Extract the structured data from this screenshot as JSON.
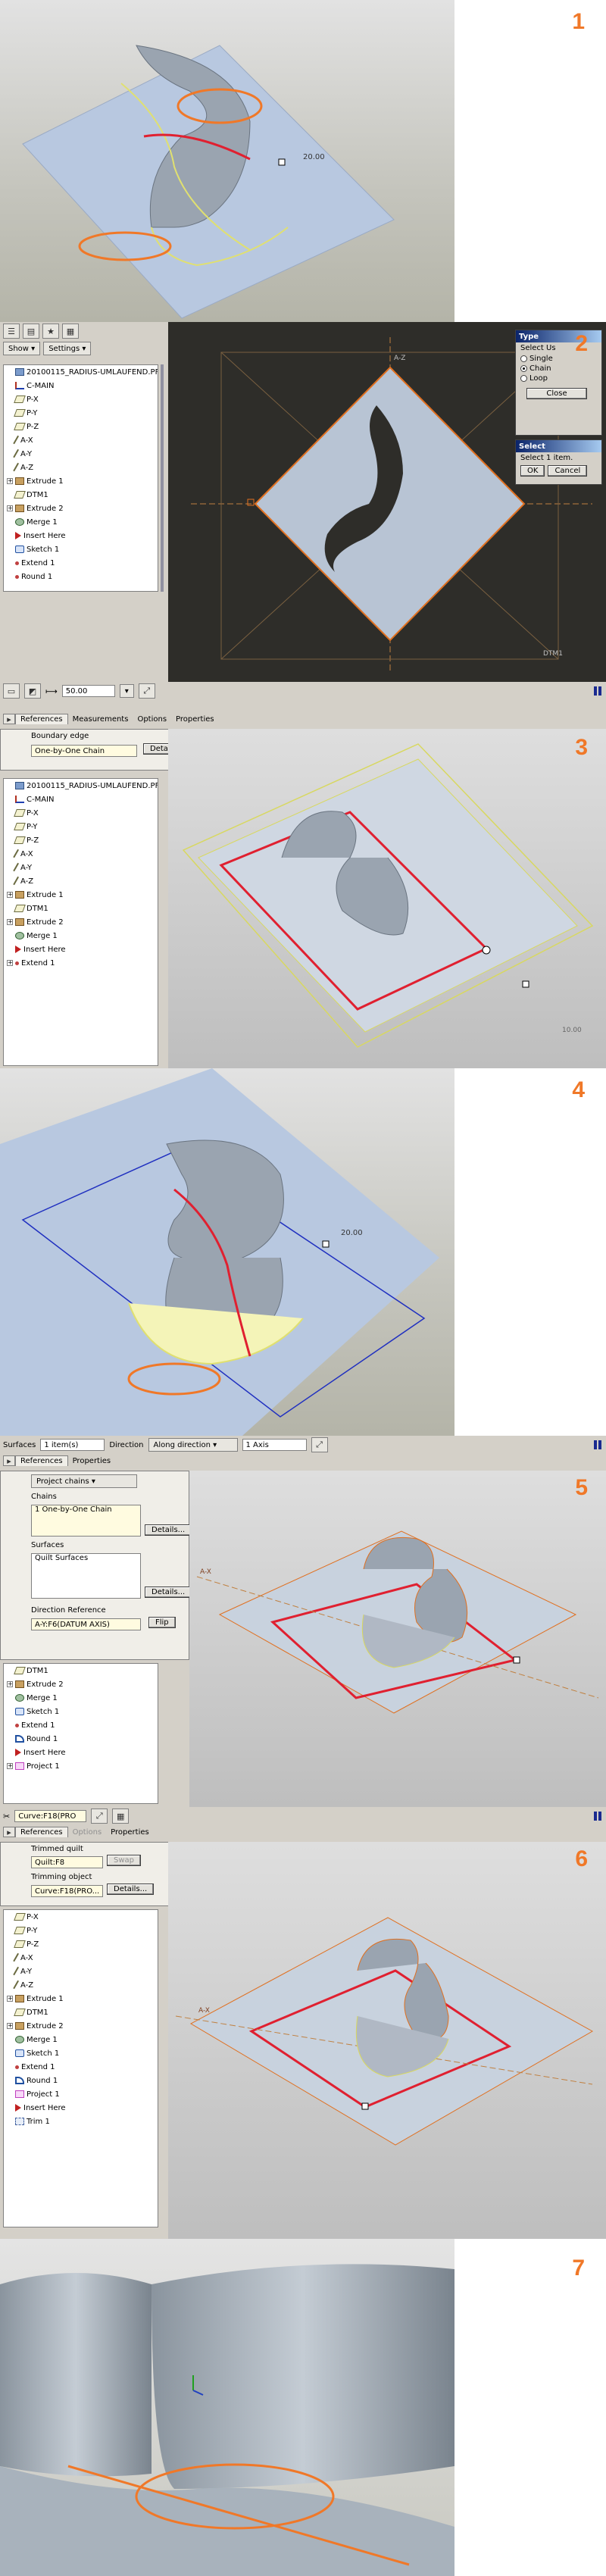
{
  "steps": [
    "1",
    "2",
    "3",
    "4",
    "5",
    "6",
    "7"
  ],
  "step1": {
    "dimension": "20.00"
  },
  "step2": {
    "toolbar": {
      "show_label": "Show",
      "settings_label": "Settings"
    },
    "tree": [
      {
        "label": "20100115_RADIUS-UMLAUFEND.PF",
        "icon": "part",
        "expander": ""
      },
      {
        "label": "C-MAIN",
        "icon": "csys",
        "expander": ""
      },
      {
        "label": "P-X",
        "icon": "plane",
        "expander": ""
      },
      {
        "label": "P-Y",
        "icon": "plane",
        "expander": ""
      },
      {
        "label": "P-Z",
        "icon": "plane",
        "expander": ""
      },
      {
        "label": "A-X",
        "icon": "axis",
        "expander": ""
      },
      {
        "label": "A-Y",
        "icon": "axis",
        "expander": ""
      },
      {
        "label": "A-Z",
        "icon": "axis",
        "expander": ""
      },
      {
        "label": "Extrude 1",
        "icon": "extrude",
        "expander": "+"
      },
      {
        "label": "DTM1",
        "icon": "plane",
        "expander": ""
      },
      {
        "label": "Extrude 2",
        "icon": "extrude",
        "expander": "+"
      },
      {
        "label": "Merge 1",
        "icon": "merge",
        "expander": ""
      },
      {
        "label": "Insert Here",
        "icon": "insert",
        "expander": ""
      },
      {
        "label": "Sketch 1",
        "icon": "sketch",
        "expander": ""
      },
      {
        "label": "Extend 1",
        "icon": "extend",
        "expander": ""
      },
      {
        "label": "Round 1",
        "icon": "extend",
        "expander": ""
      }
    ],
    "type_dialog": {
      "title": "Type",
      "select_using": "Select Us",
      "options": [
        "Single",
        "Chain",
        "Loop"
      ],
      "selected": "Chain",
      "close": "Close"
    },
    "select_dialog": {
      "title": "Select",
      "message": "Select 1 item.",
      "ok": "OK",
      "cancel": "Cancel"
    },
    "axis_labels": {
      "x": "A-X",
      "y": "A-Z",
      "dtm": "DTM1"
    },
    "dash_value": "50.00"
  },
  "step3": {
    "tabs": [
      "References",
      "Measurements",
      "Options",
      "Properties"
    ],
    "boundary_label": "Boundary edge",
    "boundary_value": "One-by-One Chain",
    "details": "Details...",
    "tree": [
      {
        "label": "20100115_RADIUS-UMLAUFEND.PF",
        "icon": "part",
        "expander": ""
      },
      {
        "label": "C-MAIN",
        "icon": "csys",
        "expander": ""
      },
      {
        "label": "P-X",
        "icon": "plane",
        "expander": ""
      },
      {
        "label": "P-Y",
        "icon": "plane",
        "expander": ""
      },
      {
        "label": "P-Z",
        "icon": "plane",
        "expander": ""
      },
      {
        "label": "A-X",
        "icon": "axis",
        "expander": ""
      },
      {
        "label": "A-Y",
        "icon": "axis",
        "expander": ""
      },
      {
        "label": "A-Z",
        "icon": "axis",
        "expander": ""
      },
      {
        "label": "Extrude 1",
        "icon": "extrude",
        "expander": "+"
      },
      {
        "label": "DTM1",
        "icon": "plane",
        "expander": ""
      },
      {
        "label": "Extrude 2",
        "icon": "extrude",
        "expander": "+"
      },
      {
        "label": "Merge 1",
        "icon": "merge",
        "expander": ""
      },
      {
        "label": "Insert Here",
        "icon": "insert",
        "expander": ""
      },
      {
        "label": "Extend 1",
        "icon": "extend",
        "expander": "+"
      }
    ],
    "dimension": "10.00"
  },
  "step4": {
    "dimension": "20.00"
  },
  "step5": {
    "surfaces_label": "Surfaces",
    "surfaces_value": "1 item(s)",
    "direction_label": "Direction",
    "direction_value": "Along direction",
    "axis_value": "1 Axis",
    "tabs": [
      "References",
      "Properties"
    ],
    "project_type": "Project chains",
    "chains_label": "Chains",
    "chains_value": "1 One-by-One Chain",
    "surfaces_list_label": "Surfaces",
    "surfaces_list_value": "Quilt Surfaces",
    "direction_ref_label": "Direction Reference",
    "direction_ref_value": "A-Y:F6(DATUM AXIS)",
    "flip": "Flip",
    "details": "Details...",
    "tree": [
      {
        "label": "DTM1",
        "icon": "plane",
        "expander": ""
      },
      {
        "label": "Extrude 2",
        "icon": "extrude",
        "expander": "+"
      },
      {
        "label": "Merge 1",
        "icon": "merge",
        "expander": ""
      },
      {
        "label": "Sketch 1",
        "icon": "sketch",
        "expander": ""
      },
      {
        "label": "Extend 1",
        "icon": "extend",
        "expander": ""
      },
      {
        "label": "Round 1",
        "icon": "round",
        "expander": ""
      },
      {
        "label": "Insert Here",
        "icon": "insert",
        "expander": ""
      },
      {
        "label": "Project 1",
        "icon": "project",
        "expander": "+"
      }
    ],
    "axis_label": "A-X"
  },
  "step6": {
    "curve_value": "Curve:F18(PRO",
    "tabs": [
      "References",
      "Options",
      "Properties"
    ],
    "trimmed_quilt_label": "Trimmed quilt",
    "trimmed_quilt_value": "Quilt:F8",
    "swap_label": "Swap",
    "trimming_object_label": "Trimming object",
    "trimming_object_value": "Curve:F18(PRO...",
    "details": "Details...",
    "tree": [
      {
        "label": "P-X",
        "icon": "plane",
        "expander": ""
      },
      {
        "label": "P-Y",
        "icon": "plane",
        "expander": ""
      },
      {
        "label": "P-Z",
        "icon": "plane",
        "expander": ""
      },
      {
        "label": "A-X",
        "icon": "axis",
        "expander": ""
      },
      {
        "label": "A-Y",
        "icon": "axis",
        "expander": ""
      },
      {
        "label": "A-Z",
        "icon": "axis",
        "expander": ""
      },
      {
        "label": "Extrude 1",
        "icon": "extrude",
        "expander": "+"
      },
      {
        "label": "DTM1",
        "icon": "plane",
        "expander": ""
      },
      {
        "label": "Extrude 2",
        "icon": "extrude",
        "expander": "+"
      },
      {
        "label": "Merge 1",
        "icon": "merge",
        "expander": ""
      },
      {
        "label": "Sketch 1",
        "icon": "sketch",
        "expander": ""
      },
      {
        "label": "Extend 1",
        "icon": "extend",
        "expander": ""
      },
      {
        "label": "Round 1",
        "icon": "round",
        "expander": ""
      },
      {
        "label": "Project 1",
        "icon": "project",
        "expander": ""
      },
      {
        "label": "Insert Here",
        "icon": "insert",
        "expander": ""
      },
      {
        "label": "Trim 1",
        "icon": "trim",
        "expander": ""
      }
    ],
    "axis_label": "A-X"
  },
  "colors": {
    "accent_orange": "#f07828",
    "plane_blue": "#b8c8e0",
    "highlight_red": "#e02030",
    "edge_yellow": "#f0f060"
  }
}
